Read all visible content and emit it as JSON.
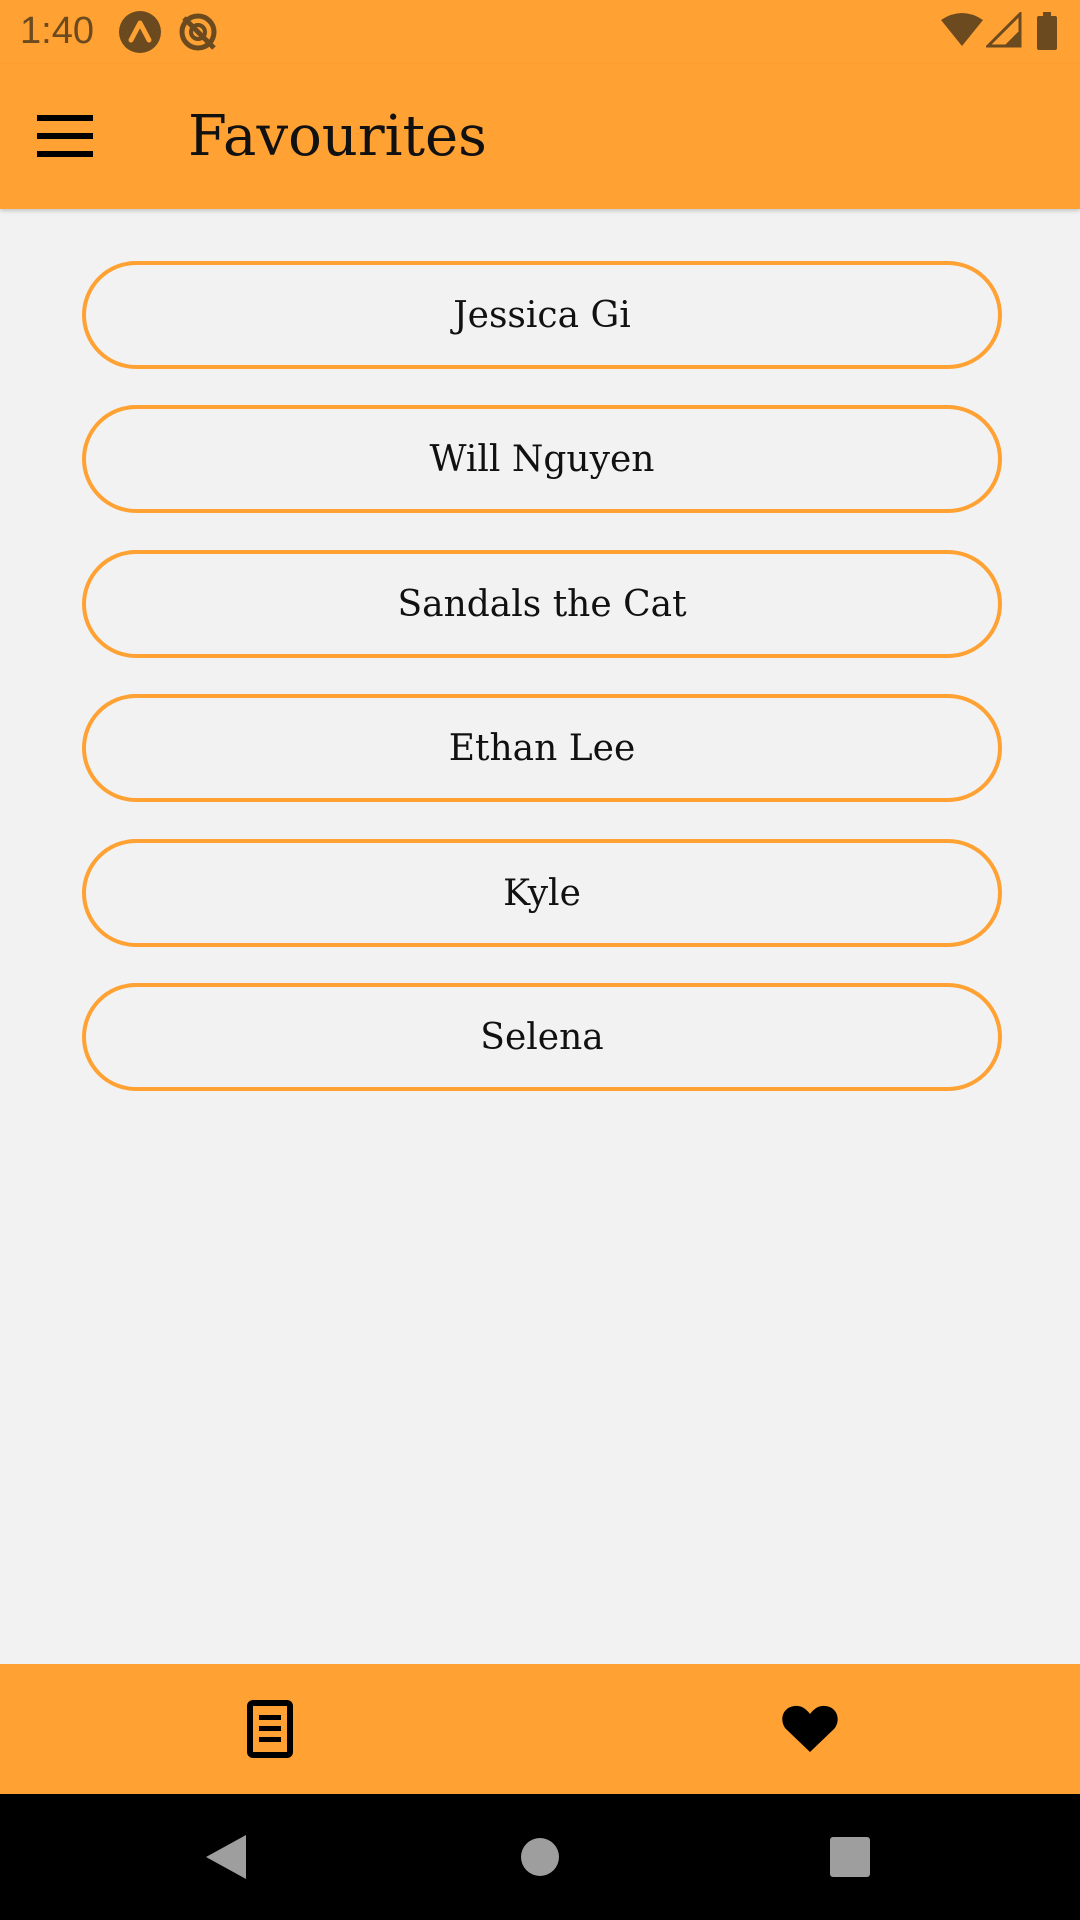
{
  "status_bar": {
    "time": "1:40",
    "icons": [
      "app-notification-icon",
      "sync-disabled-icon",
      "wifi-icon",
      "signal-icon",
      "battery-icon"
    ]
  },
  "app_bar": {
    "title": "Favourites",
    "menu_icon": "hamburger-menu-icon"
  },
  "favourites": [
    {
      "name": "Jessica Gi"
    },
    {
      "name": "Will Nguyen"
    },
    {
      "name": "Sandals the Cat"
    },
    {
      "name": "Ethan Lee"
    },
    {
      "name": "Kyle"
    },
    {
      "name": "Selena"
    }
  ],
  "bottom_nav": {
    "items": [
      {
        "icon": "list-document-icon"
      },
      {
        "icon": "heart-icon",
        "selected": true
      }
    ]
  },
  "system_nav": {
    "items": [
      "back-icon",
      "home-icon",
      "recents-icon"
    ]
  },
  "colors": {
    "accent": "#ffa133",
    "background": "#f2f2f2",
    "text": "#111111"
  }
}
